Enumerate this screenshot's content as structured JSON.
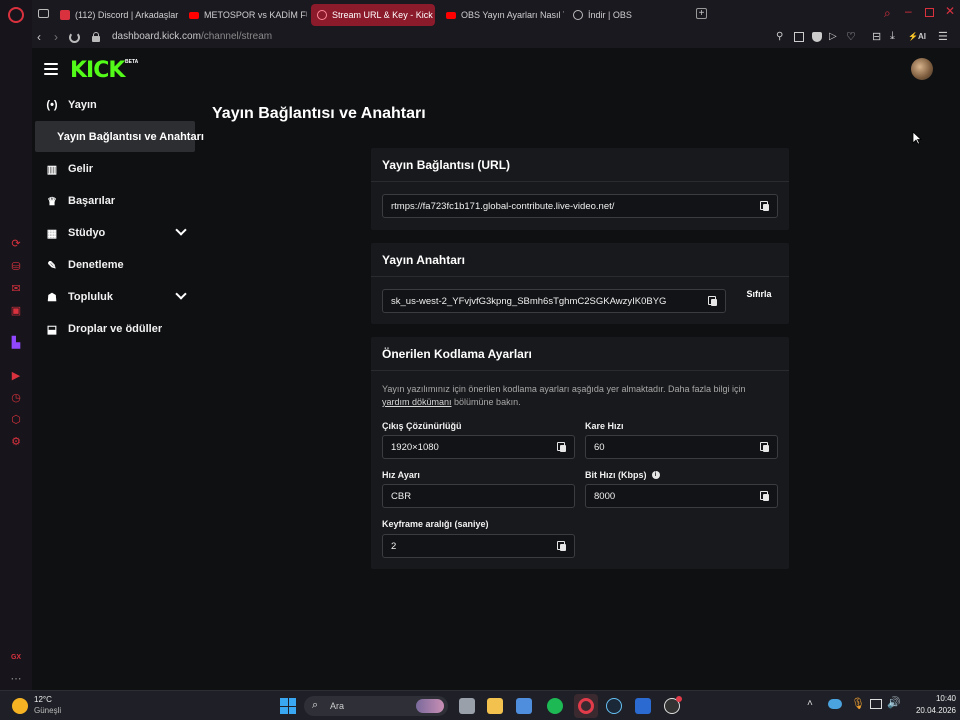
{
  "browser": {
    "tabs": [
      {
        "label": "(112) Discord | Arkadaşlar",
        "color": "#d9313e",
        "active": false
      },
      {
        "label": "METOSPOR vs KADİM FU",
        "color": "#ff0000",
        "active": false
      },
      {
        "label": "Stream URL & Key - Kick",
        "color": "#ff5a6a",
        "active": true
      },
      {
        "label": "OBS Yayın Ayarları Nasıl Y",
        "color": "#ff0000",
        "active": false
      },
      {
        "label": "İndir | OBS",
        "color": "#b8b8b8",
        "active": false
      }
    ],
    "url_host": "dashboard.kick.com",
    "url_path": "/channel/stream",
    "ai_label": "AI"
  },
  "header": {
    "logo": "KICK",
    "beta": "BETA"
  },
  "nav": {
    "items": [
      {
        "icon": "(•)",
        "label": "Yayın"
      },
      {
        "icon": "▥",
        "label": "Gelir"
      },
      {
        "icon": "♛",
        "label": "Başarılar"
      },
      {
        "icon": "▦",
        "label": "Stüdyo"
      },
      {
        "icon": "✎",
        "label": "Denetleme"
      },
      {
        "icon": "☗",
        "label": "Topluluk"
      },
      {
        "icon": "⬓",
        "label": "Droplar ve ödüller"
      }
    ],
    "sub_active": "Yayın Bağlantısı ve Anahtarı"
  },
  "page": {
    "title": "Yayın Bağlantısı ve Anahtarı"
  },
  "url_card": {
    "title": "Yayın Bağlantısı (URL)",
    "value": "rtmps://fa723fc1b171.global-contribute.live-video.net/"
  },
  "key_card": {
    "title": "Yayın Anahtarı",
    "value": "sk_us-west-2_YFvjvfG3kpng_SBmh6sTghmC2SGKAwzyIK0BYG",
    "reset": "Sıfırla"
  },
  "encoding_card": {
    "title": "Önerilen Kodlama Ayarları",
    "desc_1": "Yayın yazılımınız için önerilen kodlama ayarları aşağıda yer almaktadır. Daha fazla bilgi için",
    "desc_link": "yardım dökümanı",
    "desc_2": " bölümüne bakın.",
    "resolution_label": "Çıkış Çözünürlüğü",
    "resolution_value": "1920×1080",
    "fps_label": "Kare Hızı",
    "fps_value": "60",
    "rate_control_label": "Hız Ayarı",
    "rate_control_value": "CBR",
    "bitrate_label": "Bit Hızı (Kbps)",
    "bitrate_value": "8000",
    "keyframe_label": "Keyframe aralığı (saniye)",
    "keyframe_value": "2"
  },
  "taskbar": {
    "weather_temp": "12°C",
    "weather_desc": "Güneşli",
    "search_placeholder": "Ara",
    "time": "10:40",
    "date": "20.04.2026"
  },
  "opera": {
    "gx_label": "GX"
  }
}
